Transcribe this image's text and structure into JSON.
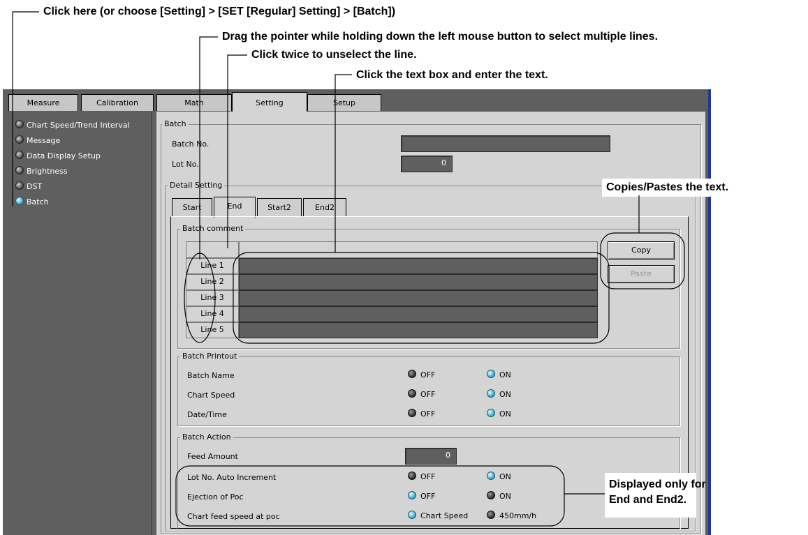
{
  "callouts": {
    "click_here": "Click here (or choose [Setting] > [SET [Regular] Setting] > [Batch])",
    "drag": "Drag the pointer while holding down the left mouse button to select multiple lines.",
    "click_twice": "Click twice to unselect the line.",
    "click_text": "Click the text box and enter the text.",
    "copy_paste": "Copies/Pastes the text.",
    "displayed_only_1": "Displayed only for",
    "displayed_only_2": "End and End2."
  },
  "tabs": [
    "Measure",
    "Calibration",
    "Math",
    "Setting",
    "Setup"
  ],
  "active_tab": "Setting",
  "sidebar": {
    "items": [
      {
        "label": "Chart Speed/Trend Interval",
        "state": "off"
      },
      {
        "label": "Message",
        "state": "off"
      },
      {
        "label": "Data Display Setup",
        "state": "off"
      },
      {
        "label": "Brightness",
        "state": "off"
      },
      {
        "label": "DST",
        "state": "off"
      },
      {
        "label": "Batch",
        "state": "on"
      }
    ]
  },
  "batch": {
    "legend": "Batch",
    "batch_no_label": "Batch No.",
    "batch_no_value": "",
    "lot_no_label": "Lot No.",
    "lot_no_value": "0",
    "detail_legend": "Detail Setting",
    "subtabs": [
      "Start",
      "End",
      "Start2",
      "End2"
    ],
    "active_subtab": "End",
    "comment": {
      "legend": "Batch comment",
      "lines": [
        "Line 1",
        "Line 2",
        "Line 3",
        "Line 4",
        "Line 5"
      ],
      "copy_label": "Copy",
      "paste_label": "Paste"
    },
    "printout": {
      "legend": "Batch Printout",
      "rows": [
        {
          "label": "Batch Name",
          "off": "OFF",
          "on": "ON",
          "value": "ON"
        },
        {
          "label": "Chart Speed",
          "off": "OFF",
          "on": "ON",
          "value": "ON"
        },
        {
          "label": "Date/Time",
          "off": "OFF",
          "on": "ON",
          "value": "ON"
        }
      ]
    },
    "action": {
      "legend": "Batch Action",
      "feed_label": "Feed Amount",
      "feed_value": "0",
      "rows": [
        {
          "label": "Lot No. Auto Increment",
          "a": "OFF",
          "b": "ON",
          "selected": "b"
        },
        {
          "label": "Ejection of Poc",
          "a": "OFF",
          "b": "ON",
          "selected": "a"
        },
        {
          "label": "Chart feed speed at poc",
          "a": "Chart Speed",
          "b": "450mm/h",
          "selected": "a"
        }
      ]
    }
  },
  "colors": {
    "panel": "#5f5f5f",
    "face": "#d4d4d4",
    "accent_border": "#1e3a9a",
    "radio_on": "#2aa2c8"
  }
}
